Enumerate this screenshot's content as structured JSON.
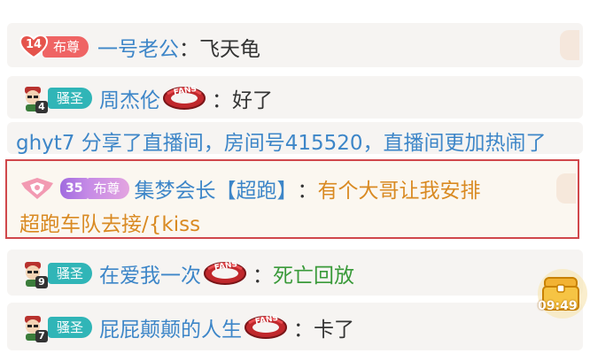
{
  "messages": [
    {
      "badge_level": "14",
      "badge_label": "布尊",
      "username": "一号老公",
      "separator": "：",
      "text": "飞天龟"
    },
    {
      "avatar_level": "4",
      "badge_label": "骚圣",
      "username": "周杰伦",
      "fans_label": "FANS",
      "separator": "：",
      "text": "好了"
    },
    {
      "system_text": "ghyt7 分享了直播间，房间号415520，直播间更加热闹了"
    },
    {
      "crown_level": "35",
      "badge_label": "布尊",
      "username": "集梦会长【超跑】",
      "separator": "：",
      "text_line1": "有个大哥让我安排",
      "text_line2": "超跑车队去接/{kiss"
    },
    {
      "avatar_level": "9",
      "badge_label": "骚圣",
      "username": "在爱我一次",
      "fans_label": "FANS",
      "separator": "：",
      "text": "死亡回放"
    },
    {
      "avatar_level": "7",
      "badge_label": "骚圣",
      "username": "屁屁颠颠的人生",
      "fans_label": "FANS",
      "separator": "：",
      "text": "卡了"
    }
  ],
  "timer": {
    "time": "09:49"
  },
  "colors": {
    "username": "#3d86c8",
    "highlight_border": "#d0474b",
    "gold_text": "#d98a22",
    "system_text": "#3d86c8",
    "death_replay": "#3a9a3a"
  }
}
